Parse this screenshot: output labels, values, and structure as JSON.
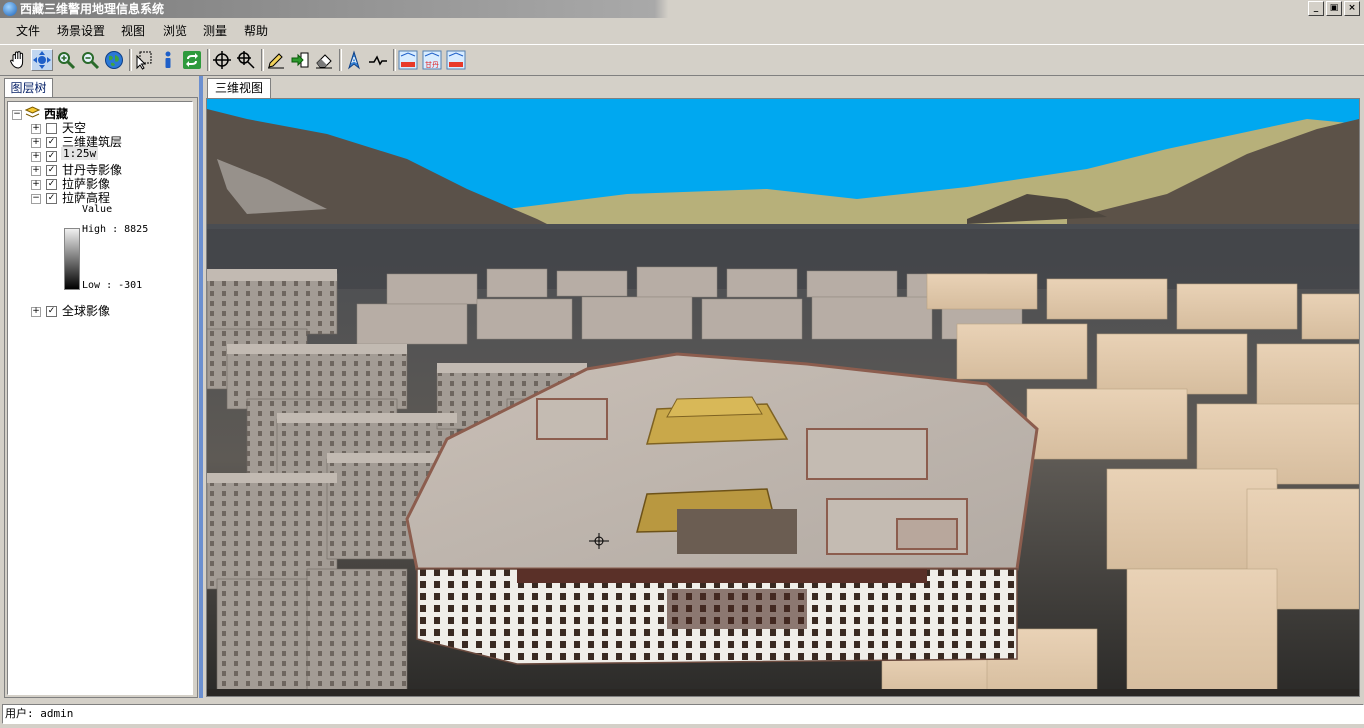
{
  "window": {
    "title": "西藏三维警用地理信息系统",
    "minimize": "_",
    "restore": "▣",
    "close": "×"
  },
  "menu": [
    "文件",
    "场景设置",
    "视图",
    "浏览",
    "测量",
    "帮助"
  ],
  "toolbar": {
    "icons": [
      "pan-hand-icon",
      "navigate-icon",
      "zoom-in-icon",
      "zoom-out-icon",
      "full-extent-globe-icon",
      "select-arrow-icon",
      "identify-info-icon",
      "refresh-icon",
      "center-target-icon",
      "zoom-target-icon",
      "edit-pencil-icon",
      "export-arrow-icon",
      "eraser-icon",
      "compass-icon",
      "profile-line-icon",
      "layer-tool-1-icon",
      "layer-tool-2-icon",
      "layer-tool-3-icon"
    ],
    "small_labels": [
      "",
      "甘丹",
      ""
    ]
  },
  "layer_panel": {
    "tab": "图层树",
    "root": "西藏",
    "items": [
      {
        "label": "天空",
        "checked": false,
        "expander": "+"
      },
      {
        "label": "三维建筑层",
        "checked": true,
        "expander": "+"
      },
      {
        "label": "1:25w",
        "checked": true,
        "expander": "+"
      },
      {
        "label": "甘丹寺影像",
        "checked": true,
        "expander": "+"
      },
      {
        "label": "拉萨影像",
        "checked": true,
        "expander": "+"
      },
      {
        "label": "拉萨高程",
        "checked": true,
        "expander": "−"
      }
    ],
    "legend": {
      "title": "Value",
      "high": "High : 8825",
      "low": "Low : -301"
    },
    "last_item": {
      "label": "全球影像",
      "checked": true,
      "expander": "+"
    }
  },
  "view_tab": "三维视图",
  "colors": {
    "sky": "#00a8f0",
    "splitter": "#6b8fd0"
  },
  "status": {
    "user": "用户: admin"
  }
}
